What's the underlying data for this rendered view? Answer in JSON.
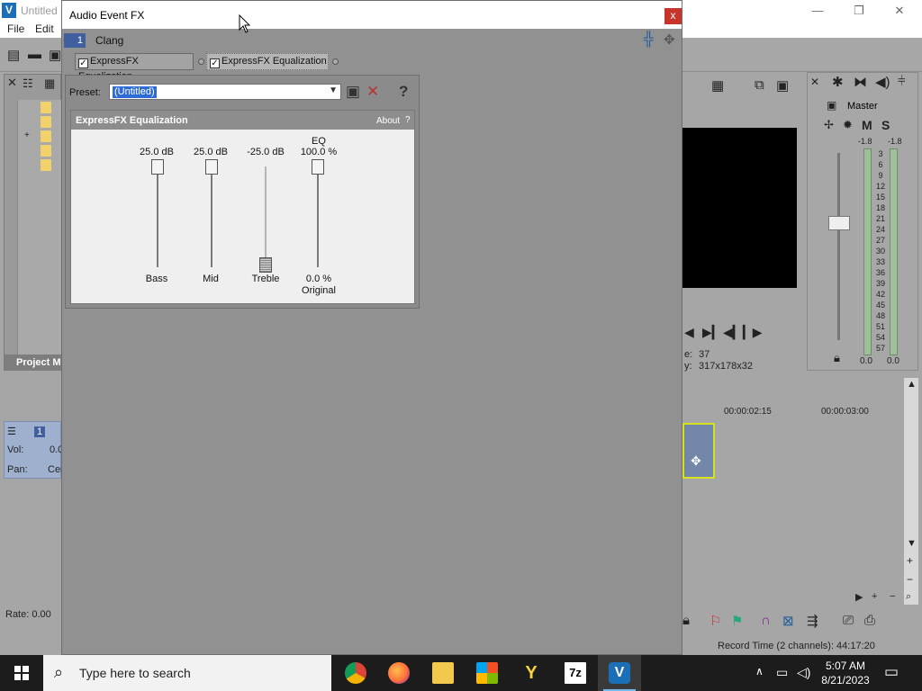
{
  "app": {
    "title": "Untitled",
    "menu": [
      "File",
      "Edit"
    ],
    "window_controls": {
      "minimize": "—",
      "maximize": "❐",
      "close": "✕"
    },
    "project_tab": "Project M",
    "track": {
      "number": "1",
      "vol_label": "Vol:",
      "vol_value": "0.0",
      "pan_label": "Pan:",
      "pan_value": "Cen"
    },
    "rate": "Rate: 0.00",
    "preview": {
      "line1_label": "e:",
      "line1_value": "37",
      "line2_label": "y:",
      "line2_value": "317x178x32"
    },
    "master": {
      "label": "Master",
      "m": "M",
      "s": "S",
      "peak_left": "-1.8",
      "peak_right": "-1.8",
      "bottom_left": "0.0",
      "bottom_right": "0.0",
      "scale": [
        "3",
        "6",
        "9",
        "12",
        "15",
        "18",
        "21",
        "24",
        "27",
        "30",
        "33",
        "36",
        "39",
        "42",
        "45",
        "48",
        "51",
        "54",
        "57"
      ]
    },
    "timeline": {
      "t1": "00:00:02:15",
      "t2": "00:00:03:00"
    },
    "status": "Record Time (2 channels): 44:17:20"
  },
  "dialog": {
    "title": "Audio Event FX",
    "close": "x",
    "chain": {
      "number": "1",
      "name": "Clang"
    },
    "fx_chips": [
      "ExpressFX Equalization",
      "ExpressFX Equalization"
    ],
    "preset_label": "Preset:",
    "preset_value": "(Untitled)",
    "plugin": {
      "title": "ExpressFX Equalization",
      "about": "About",
      "help": "?",
      "sliders": [
        {
          "name": "Bass",
          "value": "25.0 dB",
          "enabled": true
        },
        {
          "name": "Mid",
          "value": "25.0 dB",
          "enabled": true
        },
        {
          "name": "Treble",
          "value": "-25.0 dB",
          "enabled": false
        },
        {
          "name": "EQ",
          "value": "100.0 %",
          "bottom_value": "0.0 %",
          "bottom_label": "Original",
          "enabled": true
        }
      ]
    }
  },
  "taskbar": {
    "search_placeholder": "Type here to search",
    "apps": [
      "Chrome",
      "Firefox",
      "File Explorer",
      "Microsoft Store",
      "Y",
      "7z",
      "Vegas"
    ],
    "icon_7z": "7z",
    "icon_y": "Y",
    "time": "5:07 AM",
    "date": "8/21/2023"
  },
  "colors": {
    "accent": "#2f6bd5",
    "dialog_bg": "#919191",
    "close_red": "#c7342c",
    "taskbar": "#1c1c1c"
  }
}
